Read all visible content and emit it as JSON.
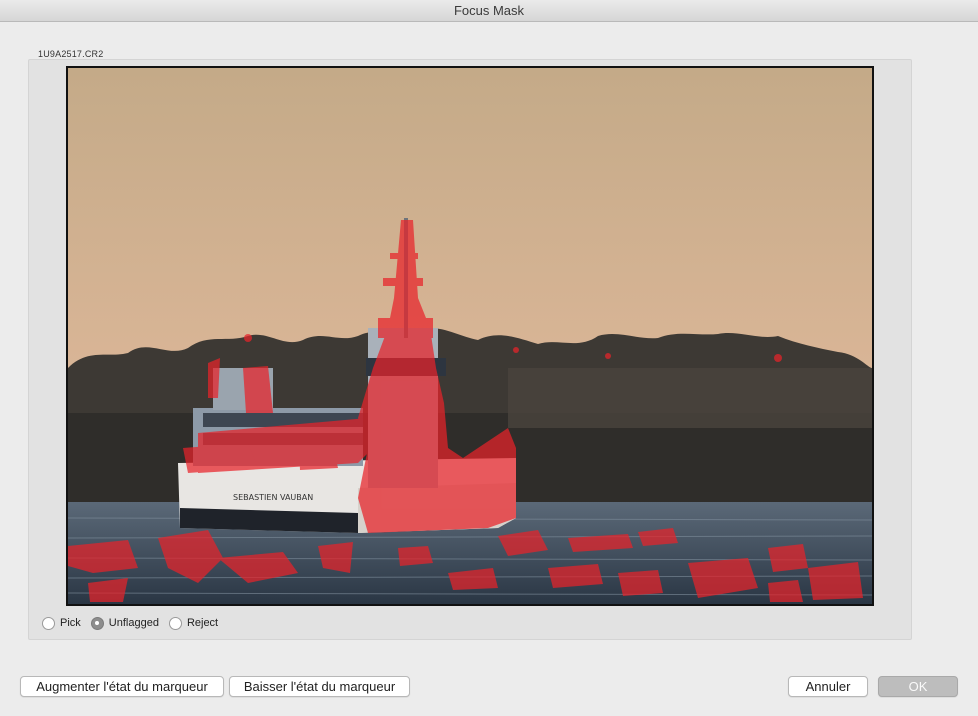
{
  "window": {
    "title": "Focus Mask"
  },
  "image": {
    "filename": "1U9A2517.CR2",
    "ship_name_text": "SEBASTIEN VAUBAN",
    "focus_overlay_color": "#e8232a"
  },
  "flags": {
    "options": [
      {
        "label": "Pick",
        "selected": false
      },
      {
        "label": "Unflagged",
        "selected": true
      },
      {
        "label": "Reject",
        "selected": false
      }
    ]
  },
  "buttons": {
    "raise_flag": "Augmenter l'état du marqueur",
    "lower_flag": "Baisser l'état du marqueur",
    "cancel": "Annuler",
    "ok": "OK"
  }
}
